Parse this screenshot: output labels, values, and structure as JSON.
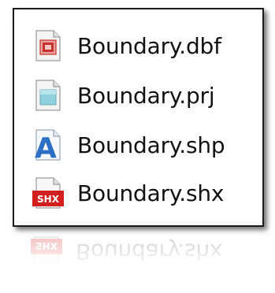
{
  "files": [
    {
      "name": "Boundary.dbf",
      "icon": "dbf-file-icon"
    },
    {
      "name": "Boundary.prj",
      "icon": "prj-file-icon"
    },
    {
      "name": "Boundary.shp",
      "icon": "shp-file-icon"
    },
    {
      "name": "Boundary.shx",
      "icon": "shx-file-icon"
    }
  ],
  "icon_labels": {
    "shp_letter": "A",
    "shx_badge": "SHX"
  },
  "colors": {
    "shx_red": "#d41f1f",
    "shp_blue": "#2a6fc4",
    "dbf_red": "#c8322d",
    "prj_teal": "#8fd0dd"
  }
}
